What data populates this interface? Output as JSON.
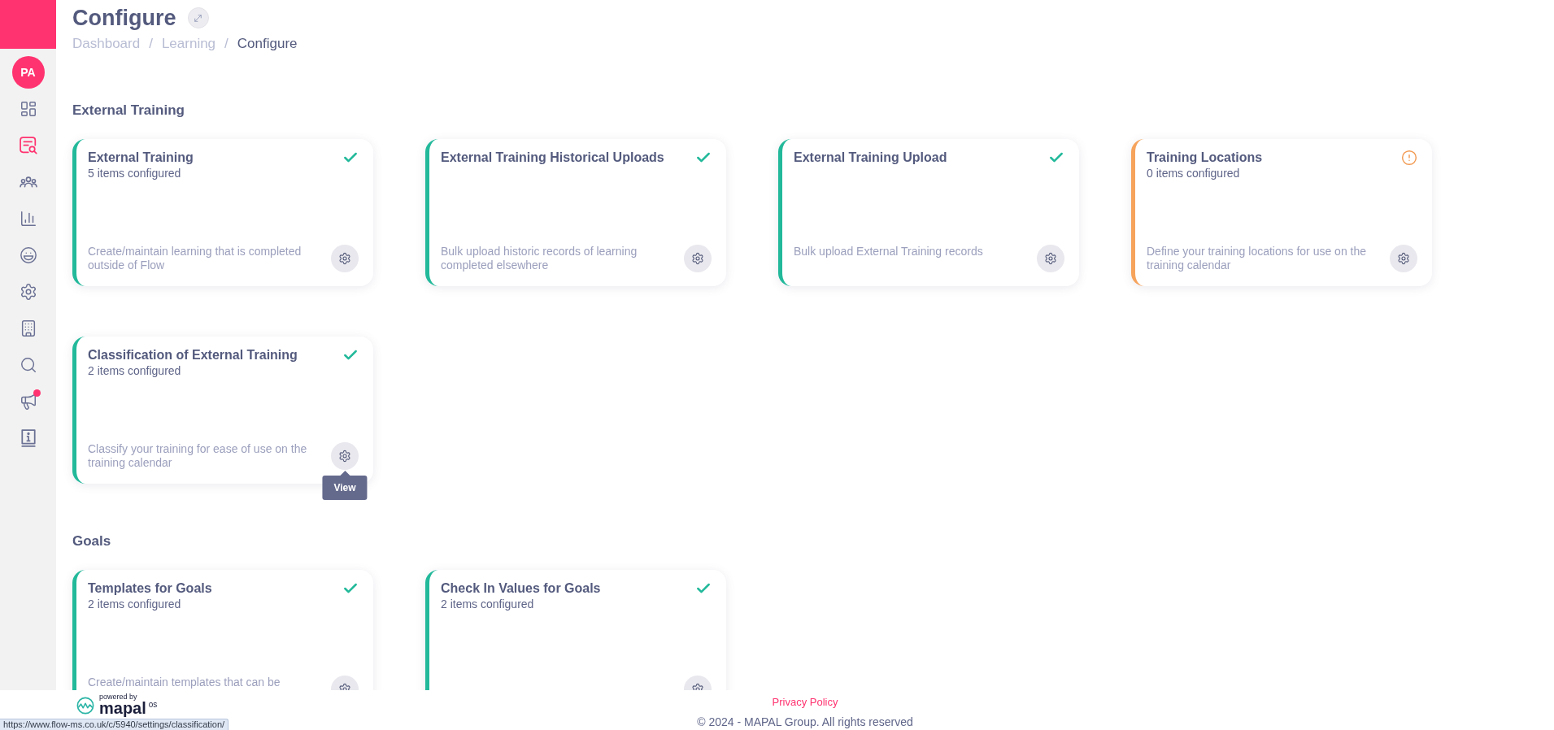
{
  "sidebar": {
    "avatar": "PA",
    "items": [
      {
        "selected": false,
        "notification": false
      },
      {
        "selected": true,
        "notification": false
      },
      {
        "selected": false,
        "notification": false
      },
      {
        "selected": false,
        "notification": false
      },
      {
        "selected": false,
        "notification": false
      },
      {
        "selected": false,
        "notification": false
      },
      {
        "selected": false,
        "notification": false
      },
      {
        "selected": false,
        "notification": false
      },
      {
        "selected": false,
        "notification": true
      },
      {
        "selected": false,
        "notification": false
      }
    ]
  },
  "header": {
    "title": "Configure",
    "breadcrumb": [
      {
        "label": "Dashboard",
        "current": false,
        "separator": "/"
      },
      {
        "label": "Learning",
        "current": false,
        "separator": "/"
      },
      {
        "label": "Configure",
        "current": true
      }
    ]
  },
  "sections": [
    {
      "heading": "External Training",
      "cards": [
        {
          "title": "External Training",
          "subtitle": "5 items configured",
          "description": "Create/maintain learning that is completed outside of Flow",
          "configured": true
        },
        {
          "title": "External Training Historical Uploads",
          "description": "Bulk upload historic records of learning completed elsewhere",
          "configured": true
        },
        {
          "title": "External Training Upload",
          "description": "Bulk upload External Training records",
          "configured": true
        },
        {
          "title": "Training Locations",
          "subtitle": "0 items configured",
          "description": "Define your training locations for use on the training calendar",
          "configured": false
        },
        {
          "title": "Classification of External Training",
          "subtitle": "2 items configured",
          "description": "Classify your training for ease of use on the training calendar",
          "configured": true,
          "tooltip": "View"
        }
      ]
    },
    {
      "heading": "Goals",
      "cards": [
        {
          "title": "Templates for Goals",
          "subtitle": "2 items configured",
          "description": "Create/maintain templates that can be",
          "configured": true
        },
        {
          "title": "Check In Values for Goals",
          "subtitle": "2 items configured",
          "configured": true
        }
      ]
    }
  ],
  "footer": {
    "powered_by": "powered by",
    "logo": "mapal",
    "logo_suffix": "os",
    "privacy_link": "Privacy Policy",
    "copyright": "© 2024 - MAPAL Group. All rights reserved"
  },
  "status_url": "https://www.flow-ms.co.uk/c/5940/settings/classification/"
}
